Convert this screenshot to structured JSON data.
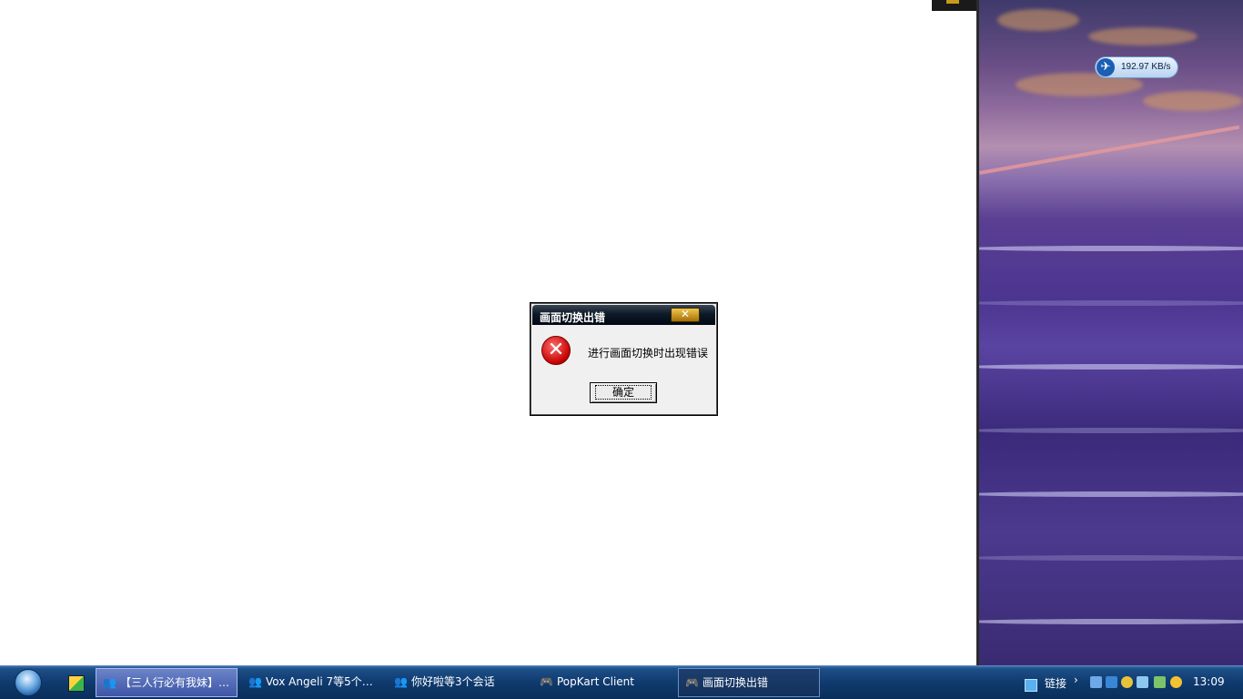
{
  "dialog": {
    "title": "画面切换出错",
    "close_glyph": "✕",
    "message": "进行画面切换时出现错误",
    "ok_label": "确定",
    "icon": "error-icon"
  },
  "desktop": {
    "speed_text": "192.97 KB/s",
    "speed_icon": "bird-icon"
  },
  "taskbar": {
    "start_icon": "windows-orb-icon",
    "tasks": [
      {
        "label": "【三人行必有我妹】…",
        "icon": "qq-group-icon"
      },
      {
        "label": "Vox Angeli 7等5个…",
        "icon": "qq-group-icon"
      },
      {
        "label": "你好啦等3个会话",
        "icon": "qq-group-icon"
      },
      {
        "label": "PopKart Client",
        "icon": "game-icon"
      },
      {
        "label": "画面切换出错",
        "icon": "game-icon"
      }
    ],
    "links_label": "链接",
    "links_chevron": "›",
    "clock": "13:09"
  },
  "colors": {
    "taskbar": "#0f3a6e",
    "dialog_title": "#0e1a28",
    "error_red": "#c40000"
  }
}
